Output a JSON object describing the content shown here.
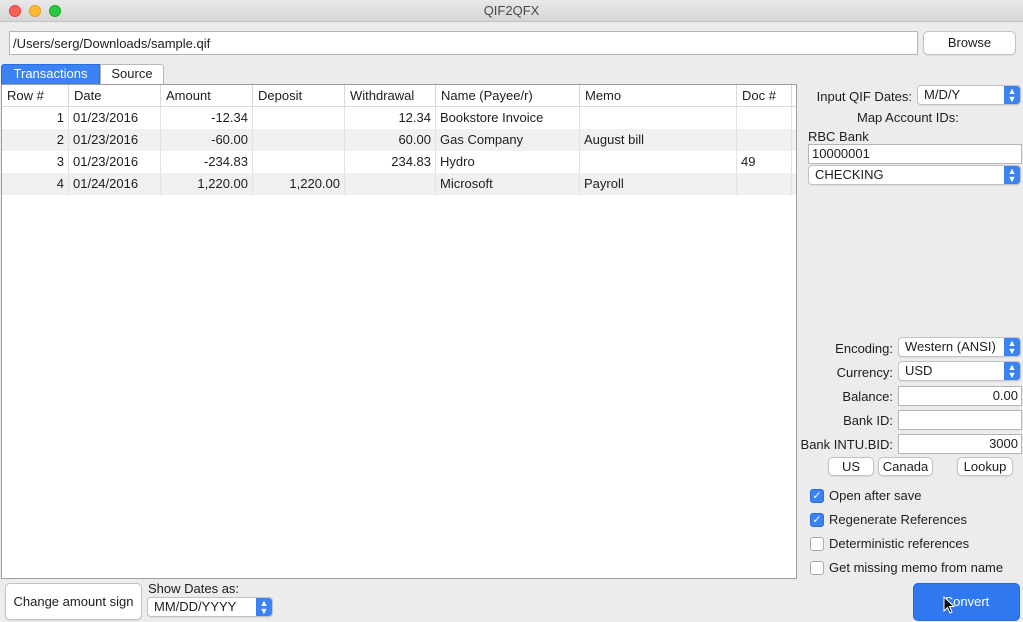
{
  "window": {
    "title": "QIF2QFX"
  },
  "file": {
    "path": "/Users/serg/Downloads/sample.qif",
    "browse_label": "Browse"
  },
  "tabs": {
    "transactions": "Transactions",
    "source": "Source"
  },
  "table": {
    "columns": [
      "Row #",
      "Date",
      "Amount",
      "Deposit",
      "Withdrawal",
      "Name (Payee/r)",
      "Memo",
      "Doc #"
    ],
    "rows": [
      {
        "row": "1",
        "date": "01/23/2016",
        "amount": "-12.34",
        "deposit": "",
        "withdrawal": "12.34",
        "name": "Bookstore Invoice",
        "memo": "",
        "doc": ""
      },
      {
        "row": "2",
        "date": "01/23/2016",
        "amount": "-60.00",
        "deposit": "",
        "withdrawal": "60.00",
        "name": "Gas Company",
        "memo": "August bill",
        "doc": ""
      },
      {
        "row": "3",
        "date": "01/23/2016",
        "amount": "-234.83",
        "deposit": "",
        "withdrawal": "234.83",
        "name": "Hydro",
        "memo": "",
        "doc": "49"
      },
      {
        "row": "4",
        "date": "01/24/2016",
        "amount": "1,220.00",
        "deposit": "1,220.00",
        "withdrawal": "",
        "name": "Microsoft",
        "memo": "Payroll",
        "doc": ""
      }
    ]
  },
  "settings": {
    "input_dates_label": "Input QIF Dates:",
    "input_dates_value": "M/D/Y",
    "map_account_label": "Map Account IDs:",
    "bank_name": "RBC Bank",
    "account_id": "10000001",
    "account_type": "CHECKING",
    "encoding_label": "Encoding:",
    "encoding_value": "Western (ANSI)",
    "currency_label": "Currency:",
    "currency_value": "USD",
    "balance_label": "Balance:",
    "balance_value": "0.00",
    "bank_id_label": "Bank ID:",
    "bank_id_value": "",
    "intu_bid_label": "Bank INTU.BID:",
    "intu_bid_value": "3000",
    "us_label": "US",
    "canada_label": "Canada",
    "lookup_label": "Lookup"
  },
  "options": [
    {
      "label": "Open after save",
      "checked": true
    },
    {
      "label": "Regenerate References",
      "checked": true
    },
    {
      "label": "Deterministic references",
      "checked": false
    },
    {
      "label": "Get missing memo from name",
      "checked": false
    }
  ],
  "bottom": {
    "change_sign_label": "Change amount sign",
    "show_dates_label": "Show Dates as:",
    "show_dates_value": "MM/DD/YYYY",
    "convert_label": "Convert"
  },
  "colors": {
    "accent": "#3b82f5",
    "convert": "#2f78f0"
  }
}
